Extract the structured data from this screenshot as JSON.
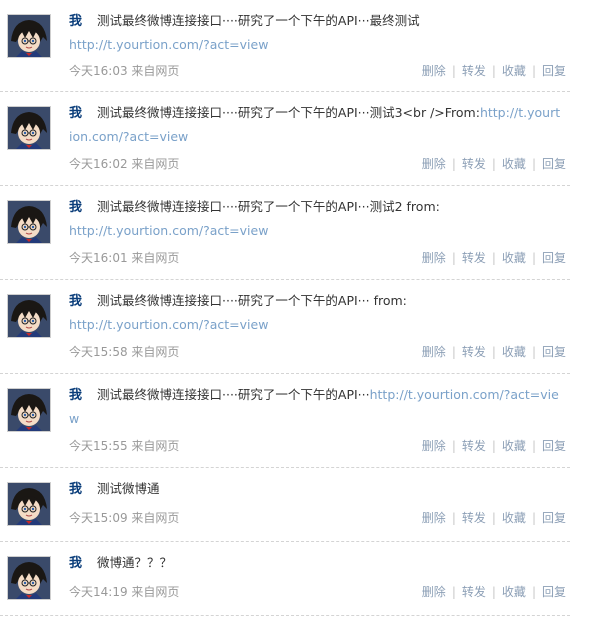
{
  "actions": {
    "delete": "删除",
    "repost": "转发",
    "favorite": "收藏",
    "reply": "回复",
    "separator": "|"
  },
  "posts": [
    {
      "author": "我",
      "text": "测试最终微博连接接口····研究了一个下午的API···最终测试",
      "link": "http://t.yourtion.com/?act=view",
      "time": "今天16:03 来自网页"
    },
    {
      "author": "我",
      "text": "测试最终微博连接接口····研究了一个下午的API···测试3<br />From:",
      "link": "http://t.yourtion.com/?act=view",
      "time": "今天16:02 来自网页"
    },
    {
      "author": "我",
      "text": "测试最终微博连接接口····研究了一个下午的API···测试2 from:",
      "link": "http://t.yourtion.com/?act=view",
      "time": "今天16:01 来自网页"
    },
    {
      "author": "我",
      "text": "测试最终微博连接接口····研究了一个下午的API··· from:",
      "link": "http://t.yourtion.com/?act=view",
      "time": "今天15:58 来自网页"
    },
    {
      "author": "我",
      "text": "测试最终微博连接接口····研究了一个下午的API···",
      "link": "http://t.yourtion.com/?act=view",
      "time": "今天15:55 来自网页"
    },
    {
      "author": "我",
      "text": "测试微博通",
      "link": "",
      "time": "今天15:09 来自网页"
    },
    {
      "author": "我",
      "text": "微博通？？？",
      "link": "",
      "time": "今天14:19 来自网页"
    }
  ]
}
